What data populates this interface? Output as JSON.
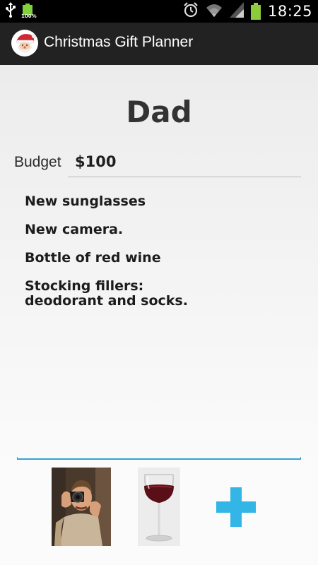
{
  "status_bar": {
    "time": "18:25",
    "battery_level_small_label": "100%",
    "icons": [
      "usb-icon",
      "battery-full-icon",
      "alarm-icon",
      "wifi-icon",
      "signal-icon",
      "battery-icon"
    ]
  },
  "app": {
    "title": "Christmas Gift Planner",
    "icon": "santa-icon"
  },
  "person": {
    "name": "Dad"
  },
  "budget": {
    "label": "Budget",
    "value": "$100"
  },
  "gifts": [
    "New sunglasses",
    "New camera.",
    "Bottle of red wine",
    "Stocking fillers:\ndeodorant and socks."
  ],
  "attachments": [
    {
      "name": "camera-photo"
    },
    {
      "name": "wine-glass-photo"
    }
  ],
  "add_button": {
    "icon": "plus-icon",
    "color": "#33b5e5"
  },
  "colors": {
    "action_bar": "#222222",
    "accent": "#33b5e5",
    "battery_green": "#8ccc3a"
  }
}
